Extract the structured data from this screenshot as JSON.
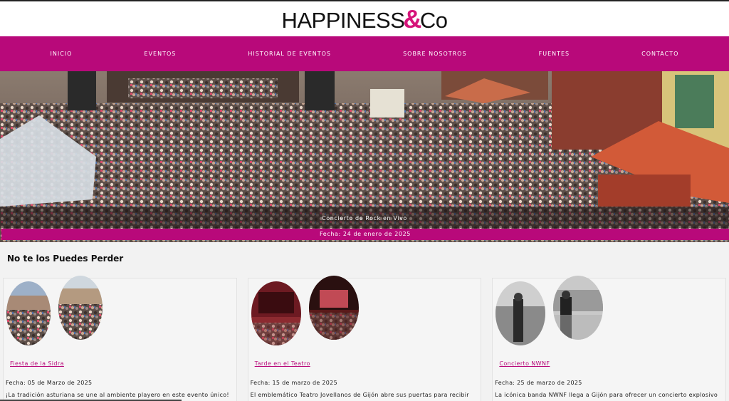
{
  "brand": {
    "name_left": "HAPPINESS",
    "amp": "&",
    "name_right": "Co"
  },
  "nav": [
    {
      "label": "Inicio"
    },
    {
      "label": "Eventos"
    },
    {
      "label": "Historial de eventos"
    },
    {
      "label": "Sobre nosotros"
    },
    {
      "label": "Fuentes"
    },
    {
      "label": "Contacto"
    }
  ],
  "hero": {
    "title": "Concierto de Rock en Vivo",
    "date": "Fecha: 24 de enero de 2025"
  },
  "section": {
    "title": "No te los Puedes Perder"
  },
  "cards": [
    {
      "link": "Fiesta de la Sidra",
      "date": "Fecha: 05 de Marzo de 2025",
      "description": "¡La tradición asturiana se une al ambiente playero en este evento único!"
    },
    {
      "link": "Tarde en el Teatro",
      "date": "Fecha: 15 de marzo de 2025",
      "description": "El emblemático Teatro Jovellanos de Gijón abre sus puertas para recibir"
    },
    {
      "link": "Concierto NWNF",
      "date": "Fecha: 25 de marzo de 2025",
      "description": "La icónica banda NWNF llega a Gijón para ofrecer un concierto explosivo"
    }
  ],
  "colors": {
    "accent": "#b8097a",
    "logo_amp": "#d6147a"
  }
}
